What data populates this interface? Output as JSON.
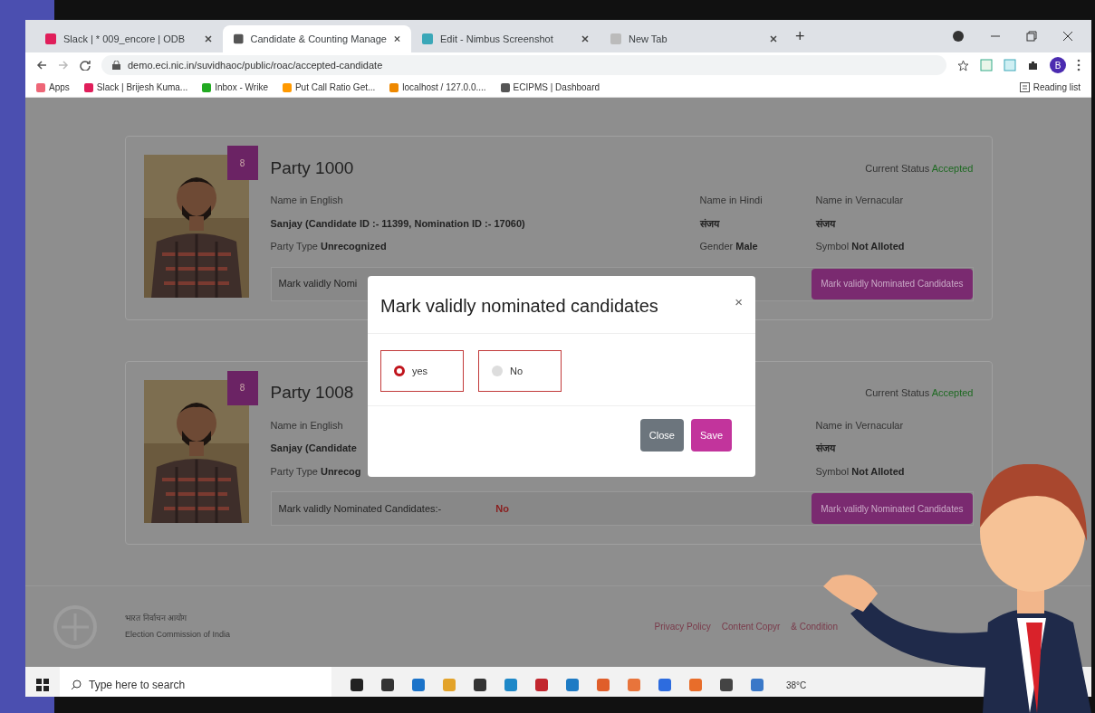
{
  "browser": {
    "tabs": [
      {
        "title": "Slack | * 009_encore | ODB",
        "selected": false
      },
      {
        "title": "Candidate & Counting Manage",
        "selected": true
      },
      {
        "title": "Edit - Nimbus Screenshot",
        "selected": false
      },
      {
        "title": "New Tab",
        "selected": false
      }
    ],
    "address": "demo.eci.nic.in/suvidhaoc/public/roac/accepted-candidate",
    "bookmarks": [
      "Apps",
      "Slack | Brijesh Kuma...",
      "Inbox - Wrike",
      "Put Call Ratio Get...",
      "localhost / 127.0.0....",
      "ECIPMS | Dashboard"
    ],
    "new_tab": "+",
    "reading_list": "Reading list",
    "profile": "B"
  },
  "cards": [
    {
      "badge": "8",
      "party": "Party 1000",
      "status_label": "Current Status",
      "status": "Accepted",
      "name_en_label": "Name in English",
      "name_en": "Sanjay (Candidate ID :- 11399, Nomination ID :- 17060)",
      "name_hi_label": "Name in Hindi",
      "name_hi": "संजय",
      "vern_label": "Name in Vernacular",
      "vern": "संजय",
      "party_type_label": "Party Type",
      "party_type": "Unrecognized",
      "gender_label": "Gender",
      "gender": "Male",
      "symbol_label": "Symbol",
      "symbol": "Not Alloted",
      "mark_label": "Mark validly Nomi",
      "button": "Mark validly Nominated Candidates"
    },
    {
      "badge": "8",
      "party": "Party 1008",
      "status_label": "Current Status",
      "status": "Accepted",
      "name_en_label": "Name in English",
      "name_en": "Sanjay (Candidate",
      "vern_label": "Name in Vernacular",
      "vern": "संजय",
      "party_type_label": "Party Type",
      "party_type": "Unrecog",
      "symbol_label": "Symbol",
      "symbol": "Not Alloted",
      "mark_label": "Mark validly Nominated Candidates:-",
      "mark_value": "No",
      "button": "Mark validly Nominated Candidates"
    }
  ],
  "modal": {
    "title": "Mark validly nominated candidates",
    "close": "×",
    "options": [
      {
        "label": "yes",
        "selected": true
      },
      {
        "label": "No",
        "selected": false
      }
    ],
    "buttons": [
      {
        "label": "Close",
        "kind": "secondary"
      },
      {
        "label": "Save",
        "kind": "primary"
      }
    ]
  },
  "footer": {
    "org_hindi": "भारत निर्वाचन आयोग",
    "org": "Election Commission of India",
    "links": [
      "Privacy Policy",
      "Content Copyr",
      "& Condition"
    ]
  },
  "taskbar": {
    "search_placeholder": "Type here to search",
    "weather": "38°C"
  }
}
